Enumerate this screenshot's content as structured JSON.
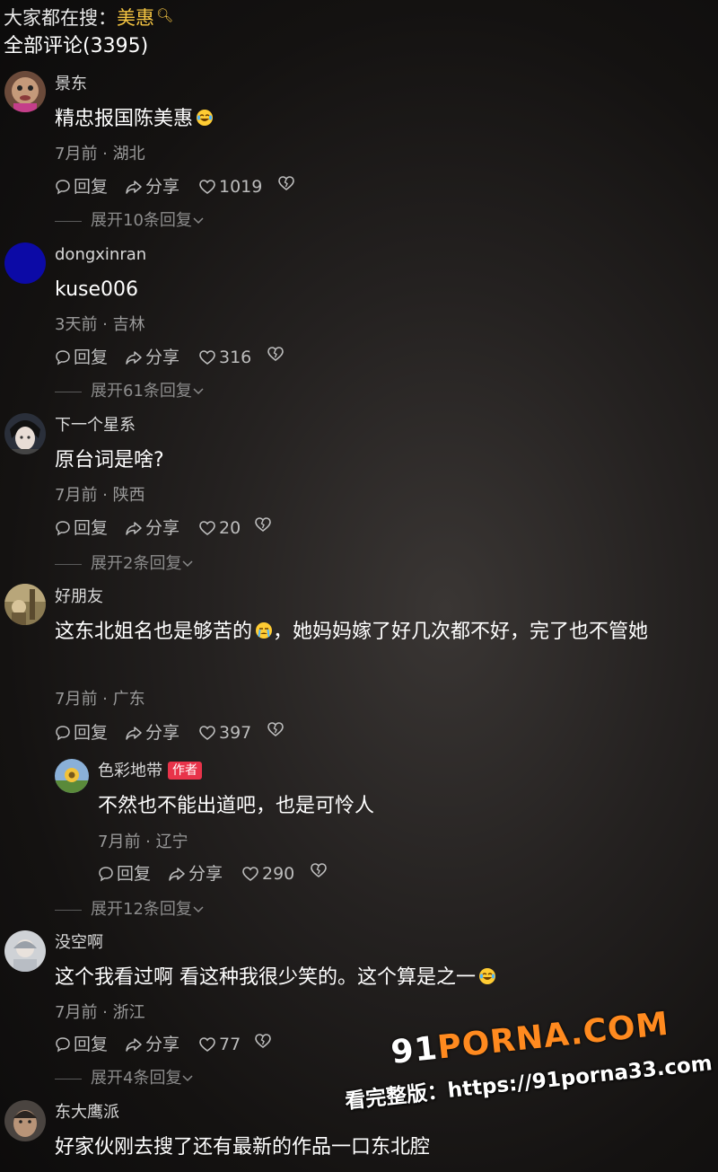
{
  "header": {
    "search_prefix": "大家都在搜：",
    "search_keyword": "美惠",
    "total_comments": "全部评论(3395)"
  },
  "labels": {
    "reply": "回复",
    "share": "分享",
    "author_tag": "作者"
  },
  "comments": [
    {
      "username": "景东",
      "text": "精忠报国陈美惠",
      "time": "7月前",
      "location": "湖北",
      "likes": "1019",
      "expand": "展开10条回复",
      "emoji": "laugh-cry-emoji"
    },
    {
      "username": "dongxinran",
      "text": "kuse006",
      "time": "3天前",
      "location": "吉林",
      "likes": "316",
      "expand": "展开61条回复"
    },
    {
      "username": "下一个星系",
      "text": "原台词是啥?",
      "time": "7月前",
      "location": "陕西",
      "likes": "20",
      "expand": "展开2条回复"
    },
    {
      "username": "好朋友",
      "text": "这东北姐名也是够苦的",
      "text_after_emoji": "，她妈妈嫁了好几次都不好，完了也不管她",
      "time": "7月前",
      "location": "广东",
      "likes": "397",
      "expand": "展开12条回复",
      "emoji": "crying-emoji",
      "reply": {
        "username": "色彩地带",
        "text": "不然也不能出道吧，也是可怜人",
        "time": "7月前",
        "location": "辽宁",
        "likes": "290"
      }
    },
    {
      "username": "没空啊",
      "text": "这个我看过啊 看这种我很少笑的。这个算是之一",
      "time": "7月前",
      "location": "浙江",
      "likes": "77",
      "expand": "展开4条回复",
      "emoji": "laugh-cry-emoji"
    },
    {
      "username": "东大鹰派",
      "text": "好家伙刚去搜了还有最新的作品一口东北腔"
    }
  ],
  "watermark": {
    "logo_prefix": "91",
    "logo_rest": "PORNA.COM",
    "line": "看完整版：https://91porna33.com"
  },
  "colors": {
    "keyword": "#f5c542",
    "author_tag": "#e8334a",
    "watermark_accent": "#ff8a1f"
  }
}
